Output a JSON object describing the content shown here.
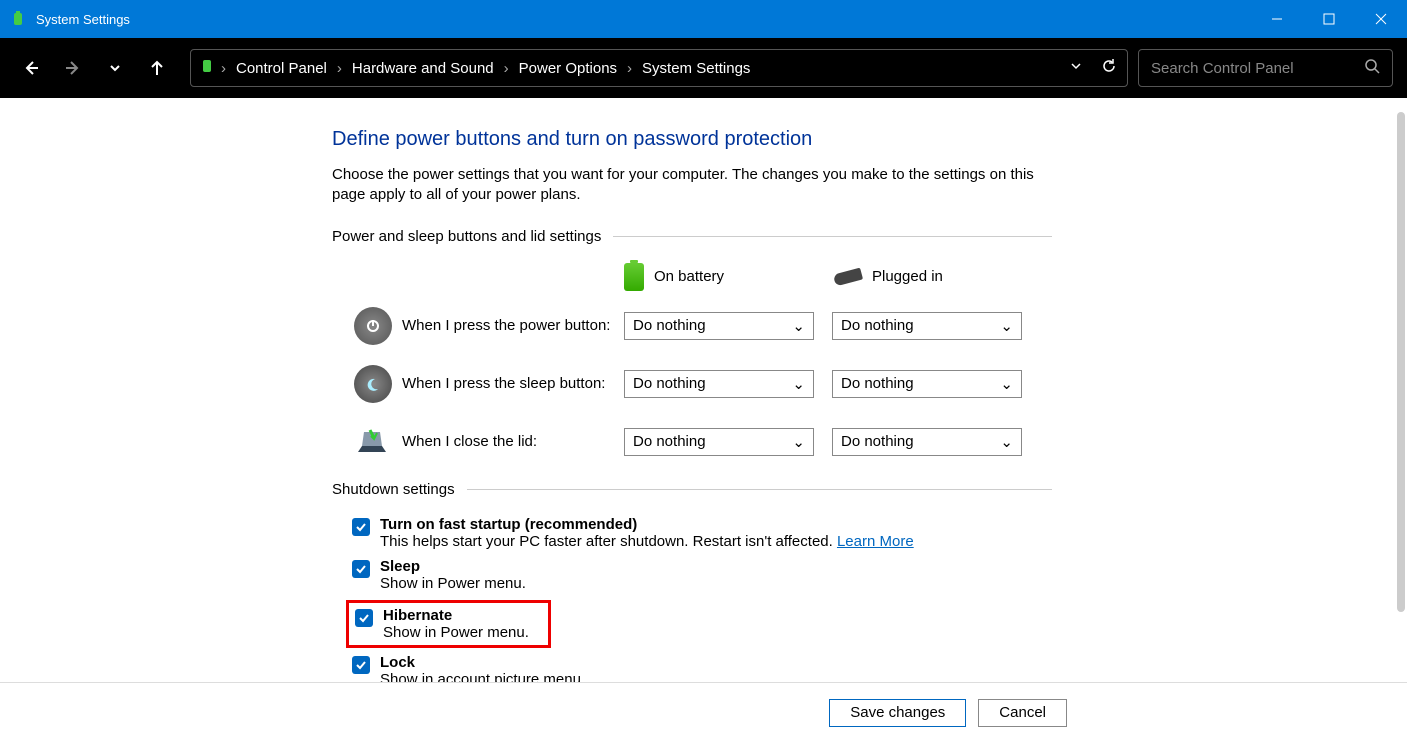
{
  "titlebar": {
    "title": "System Settings"
  },
  "breadcrumb": {
    "items": [
      "Control Panel",
      "Hardware and Sound",
      "Power Options",
      "System Settings"
    ]
  },
  "search": {
    "placeholder": "Search Control Panel"
  },
  "page": {
    "heading": "Define power buttons and turn on password protection",
    "description": "Choose the power settings that you want for your computer. The changes you make to the settings on this page apply to all of your power plans."
  },
  "section1": {
    "label": "Power and sleep buttons and lid settings",
    "col_battery": "On battery",
    "col_plugged": "Plugged in",
    "rows": [
      {
        "label": "When I press the power button:",
        "battery": "Do nothing",
        "plugged": "Do nothing"
      },
      {
        "label": "When I press the sleep button:",
        "battery": "Do nothing",
        "plugged": "Do nothing"
      },
      {
        "label": "When I close the lid:",
        "battery": "Do nothing",
        "plugged": "Do nothing"
      }
    ]
  },
  "section2": {
    "label": "Shutdown settings",
    "items": [
      {
        "title": "Turn on fast startup (recommended)",
        "desc": "This helps start your PC faster after shutdown. Restart isn't affected.",
        "link": "Learn More"
      },
      {
        "title": "Sleep",
        "desc": "Show in Power menu."
      },
      {
        "title": "Hibernate",
        "desc": "Show in Power menu."
      },
      {
        "title": "Lock",
        "desc": "Show in account picture menu."
      }
    ]
  },
  "footer": {
    "save": "Save changes",
    "cancel": "Cancel"
  }
}
